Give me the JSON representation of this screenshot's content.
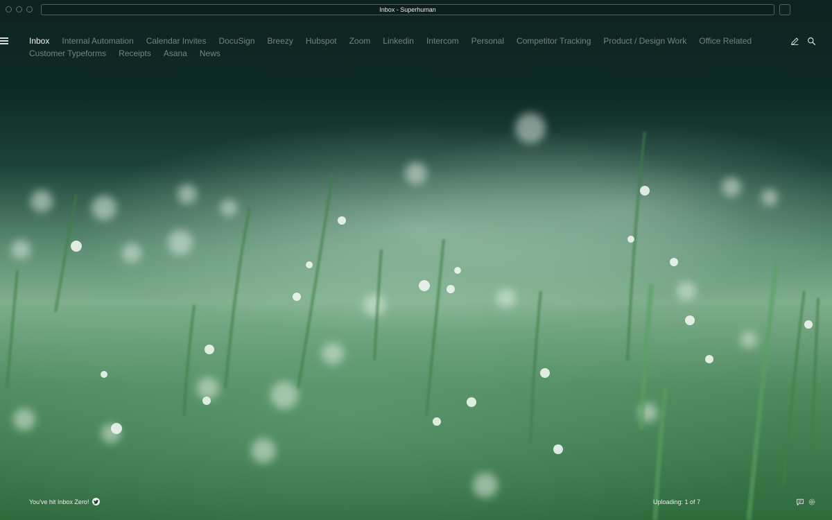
{
  "window": {
    "title": "Inbox - Superhuman"
  },
  "nav": {
    "tabs": [
      {
        "label": "Inbox",
        "active": true
      },
      {
        "label": "Internal Automation",
        "active": false
      },
      {
        "label": "Calendar Invites",
        "active": false
      },
      {
        "label": "DocuSign",
        "active": false
      },
      {
        "label": "Breezy",
        "active": false
      },
      {
        "label": "Hubspot",
        "active": false
      },
      {
        "label": "Zoom",
        "active": false
      },
      {
        "label": "Linkedin",
        "active": false
      },
      {
        "label": "Intercom",
        "active": false
      },
      {
        "label": "Personal",
        "active": false
      },
      {
        "label": "Competitor Tracking",
        "active": false
      },
      {
        "label": "Product / Design Work",
        "active": false
      },
      {
        "label": "Office Related",
        "active": false
      },
      {
        "label": "Customer Typeforms",
        "active": false
      },
      {
        "label": "Receipts",
        "active": false
      },
      {
        "label": "Asana",
        "active": false
      },
      {
        "label": "News",
        "active": false
      }
    ]
  },
  "icons": {
    "menu": "menu-icon",
    "compose": "pencil-icon",
    "search": "search-icon",
    "twitter": "twitter-icon",
    "feedback": "chat-icon",
    "settings": "gear-icon"
  },
  "footer": {
    "message": "You've hit Inbox Zero!",
    "upload_status": "Uploading: 1 of 7"
  }
}
